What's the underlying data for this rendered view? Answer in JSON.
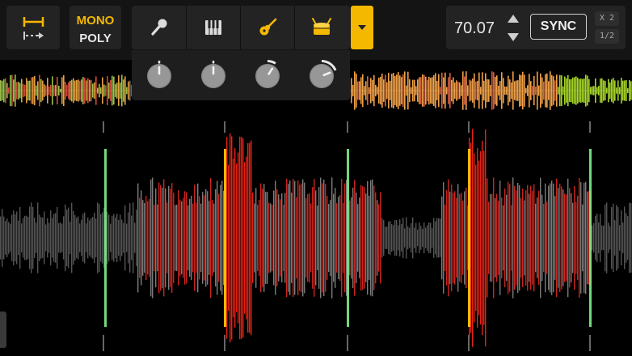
{
  "toolbar": {
    "loop_icon": "loop-length-icon",
    "mode": {
      "mono_label": "MONO",
      "poly_label": "POLY",
      "active": "mono"
    },
    "stems": [
      {
        "name": "vocals",
        "icon": "microphone-icon"
      },
      {
        "name": "melody",
        "icon": "piano-keys-icon"
      },
      {
        "name": "instruments",
        "icon": "guitar-icon"
      },
      {
        "name": "drums",
        "icon": "drum-icon"
      }
    ],
    "dropdown_icon": "chevron-down-icon"
  },
  "knobs": [
    {
      "name": "vocals",
      "level": 0.5
    },
    {
      "name": "melody",
      "level": 0.5
    },
    {
      "name": "instruments",
      "level": 0.62
    },
    {
      "name": "drums",
      "level": 0.75
    }
  ],
  "tempo": {
    "bpm": "70.07",
    "sync_label": "SYNC",
    "x2_label": "X 2",
    "half_label": "1/2"
  },
  "colors": {
    "accent": "#f5b800",
    "background": "#000000",
    "panel": "#232323",
    "wave_red": "#ff2a1a",
    "wave_green": "#5be37a",
    "wave_gray": "#6a6a6a",
    "overview_orange": "#e8a040"
  }
}
